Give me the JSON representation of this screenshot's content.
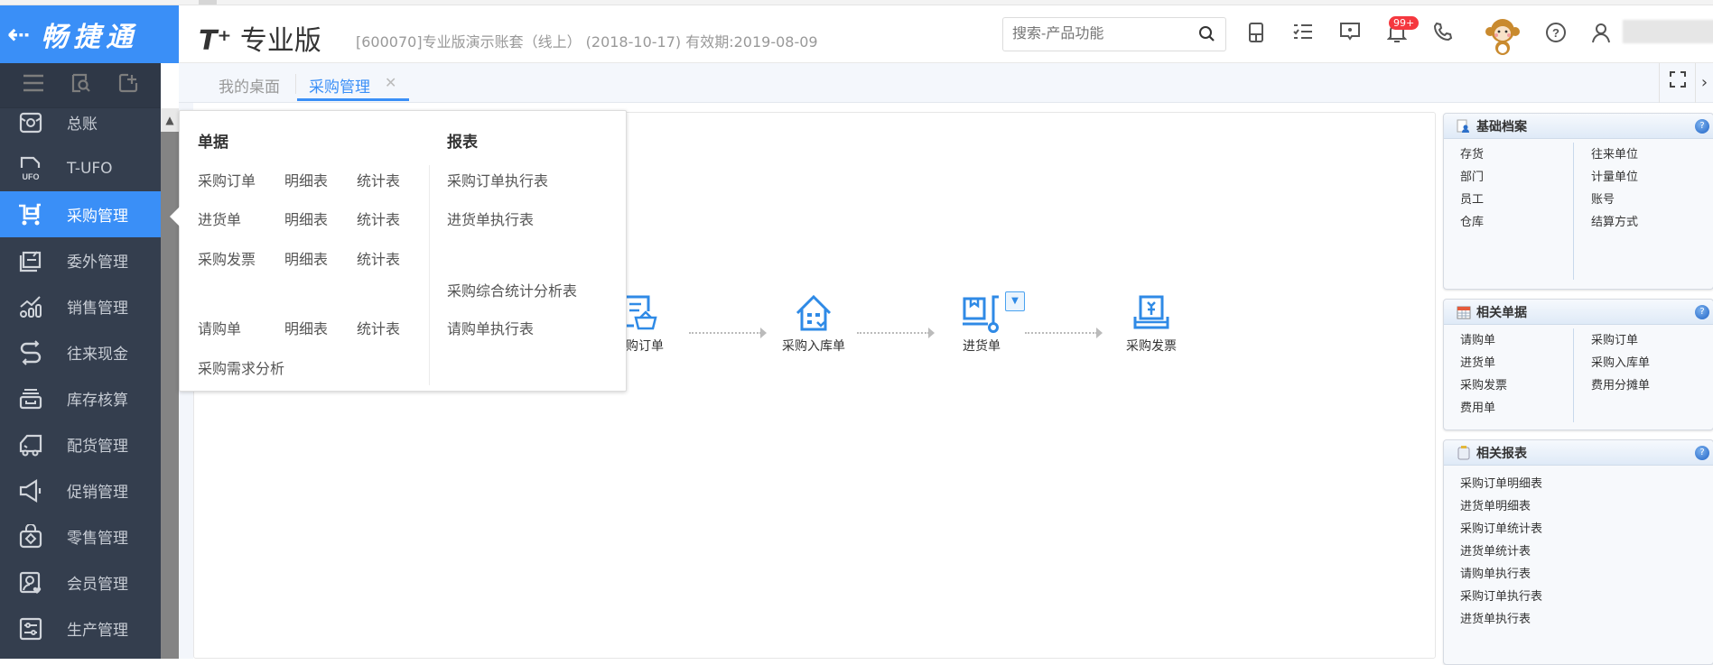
{
  "logo": {
    "back_icon": "back-arrow-icon",
    "brand": "畅捷通"
  },
  "header": {
    "product_prefix": "T⁺",
    "product_name": "专业版",
    "account_info": "[600070]专业版演示账套（线上） (2018-10-17)  有效期:2019-08-09",
    "search_placeholder": "搜索-产品功能",
    "notification_badge": "99+",
    "icons": [
      "search-icon",
      "mobile-icon",
      "task-list-icon",
      "message-icon",
      "bell-icon",
      "phone-icon",
      "monkey-avatar-icon",
      "help-icon",
      "user-icon"
    ]
  },
  "sidebar": {
    "tools": [
      "menu-icon",
      "search-box-icon",
      "add-shortcut-icon"
    ],
    "items": [
      {
        "label": "总账",
        "icon": "ledger-icon",
        "active": false
      },
      {
        "label": "T-UFO",
        "icon": "ufo-report-icon",
        "active": false
      },
      {
        "label": "采购管理",
        "icon": "cart-icon",
        "active": true
      },
      {
        "label": "委外管理",
        "icon": "outsource-icon",
        "active": false
      },
      {
        "label": "销售管理",
        "icon": "sales-chart-icon",
        "active": false
      },
      {
        "label": "往来现金",
        "icon": "exchange-icon",
        "active": false
      },
      {
        "label": "库存核算",
        "icon": "inventory-icon",
        "active": false
      },
      {
        "label": "配货管理",
        "icon": "truck-icon",
        "active": false
      },
      {
        "label": "促销管理",
        "icon": "megaphone-icon",
        "active": false
      },
      {
        "label": "零售管理",
        "icon": "retail-bag-icon",
        "active": false
      },
      {
        "label": "会员管理",
        "icon": "member-icon",
        "active": false
      },
      {
        "label": "生产管理",
        "icon": "production-icon",
        "active": false
      }
    ]
  },
  "tabs": [
    {
      "label": "我的桌面",
      "active": false
    },
    {
      "label": "采购管理",
      "active": true,
      "closable": true
    }
  ],
  "tab_tools": [
    "fullscreen-icon",
    "chevron-right-icon"
  ],
  "menu": {
    "documents_heading": "单据",
    "reports_heading": "报表",
    "documents": [
      {
        "name": "采购订单",
        "detail": "明细表",
        "stats": "统计表"
      },
      {
        "name": "进货单",
        "detail": "明细表",
        "stats": "统计表"
      },
      {
        "name": "采购发票",
        "detail": "明细表",
        "stats": "统计表"
      },
      {
        "name": "请购单",
        "detail": "明细表",
        "stats": "统计表"
      },
      {
        "name": "采购需求分析"
      }
    ],
    "reports": [
      "采购订单执行表",
      "进货单执行表",
      "采购综合统计分析表",
      "请购单执行表"
    ]
  },
  "flow": {
    "nodes": [
      {
        "label": "采购订单",
        "icon": "purchase-order-icon"
      },
      {
        "label": "采购入库单",
        "icon": "warehouse-in-icon"
      },
      {
        "label": "进货单",
        "icon": "receiving-icon",
        "has_dropdown": true
      },
      {
        "label": "采购发票",
        "icon": "invoice-icon"
      }
    ]
  },
  "panels": {
    "basic": {
      "title": "基础档案",
      "left": [
        "存货",
        "部门",
        "员工",
        "仓库"
      ],
      "right": [
        "往来单位",
        "计量单位",
        "账号",
        "结算方式"
      ]
    },
    "docs": {
      "title": "相关单据",
      "left": [
        "请购单",
        "进货单",
        "采购发票",
        "费用单"
      ],
      "right": [
        "采购订单",
        "采购入库单",
        "费用分摊单"
      ]
    },
    "reports": {
      "title": "相关报表",
      "items": [
        "采购订单明细表",
        "进货单明细表",
        "采购订单统计表",
        "进货单统计表",
        "请购单执行表",
        "采购订单执行表",
        "进货单执行表"
      ]
    }
  },
  "colors": {
    "brand": "#3a8ff7",
    "sidebar_bg": "#343e4e",
    "badge": "#f5383f",
    "flow_icon": "#2f8ae6"
  }
}
